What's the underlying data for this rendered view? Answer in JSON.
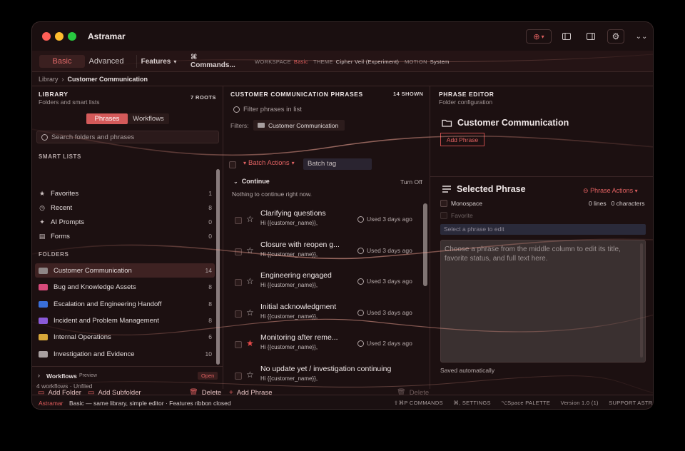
{
  "app": {
    "title": "Astramar"
  },
  "ribbon": {
    "mode_basic": "Basic",
    "mode_advanced": "Advanced",
    "features": "Features",
    "commands": "⌘ Commands...",
    "workspace_label": "WORKSPACE",
    "workspace_value": "Basic",
    "theme_label": "THEME",
    "theme_value": "Cipher Veil (Experiment)",
    "motion_label": "MOTION",
    "motion_value": "System"
  },
  "breadcrumb": {
    "root": "Library",
    "current": "Customer Communication"
  },
  "library": {
    "title": "LIBRARY",
    "subtitle": "Folders and smart lists",
    "roots": "7 ROOTS",
    "tab_phrases": "Phrases",
    "tab_workflows": "Workflows",
    "search_placeholder": "Search folders and phrases",
    "smart_lists_title": "SMART LISTS",
    "smart_lists": [
      {
        "label": "Favorites",
        "count": "1",
        "icon": "star-icon"
      },
      {
        "label": "Recent",
        "count": "8",
        "icon": "clock-icon"
      },
      {
        "label": "AI Prompts",
        "count": "0",
        "icon": "sparkle-icon"
      },
      {
        "label": "Forms",
        "count": "0",
        "icon": "form-icon"
      }
    ],
    "folders_title": "FOLDERS",
    "folders": [
      {
        "label": "Customer Communication",
        "count": "14",
        "color": "#8e8686"
      },
      {
        "label": "Bug and Knowledge Assets",
        "count": "8",
        "color": "#d64a7a"
      },
      {
        "label": "Escalation and Engineering Handoff",
        "count": "8",
        "color": "#3a6fd8"
      },
      {
        "label": "Incident and Problem Management",
        "count": "8",
        "color": "#8a5ad8"
      },
      {
        "label": "Internal Operations",
        "count": "6",
        "color": "#d8a83a"
      },
      {
        "label": "Investigation and Evidence",
        "count": "10",
        "color": "#a8a0a0"
      }
    ],
    "workflows_title": "Workflows",
    "workflows_preview": "Preview",
    "workflows_open": "Open",
    "workflows_sub": "4 workflows · Unfiled",
    "add_folder": "Add Folder",
    "add_subfolder": "Add Subfolder",
    "delete": "Delete"
  },
  "phrases": {
    "title": "CUSTOMER COMMUNICATION PHRASES",
    "shown": "14 SHOWN",
    "filter_placeholder": "Filter phrases in list",
    "filters_label": "Filters:",
    "filter_chip": "Customer Communication",
    "batch_actions": "Batch Actions",
    "batch_tag": "Batch tag",
    "continue_title": "Continue",
    "turn_off": "Turn Off",
    "continue_empty": "Nothing to continue right now.",
    "items": [
      {
        "title": "Clarifying questions",
        "snippet": "Hi {{customer_name}},",
        "used": "Used 3 days ago",
        "favorite": false
      },
      {
        "title": "Closure with reopen g...",
        "snippet": "Hi {{customer_name}},",
        "used": "Used 3 days ago",
        "favorite": false
      },
      {
        "title": "Engineering engaged",
        "snippet": "Hi {{customer_name}},",
        "used": "Used 3 days ago",
        "favorite": false
      },
      {
        "title": "Initial acknowledgment",
        "snippet": "Hi {{customer_name}},",
        "used": "Used 3 days ago",
        "favorite": false
      },
      {
        "title": "Monitoring after reme...",
        "snippet": "Hi {{customer_name}},",
        "used": "Used 2 days ago",
        "favorite": true
      },
      {
        "title": "No update yet / investigation continuing",
        "snippet": "Hi {{customer_name}},",
        "used": "",
        "favorite": false
      }
    ],
    "add_phrase": "Add Phrase",
    "delete": "Delete"
  },
  "editor": {
    "title": "PHRASE EDITOR",
    "subtitle": "Folder configuration",
    "folder_name": "Customer Communication",
    "add_phrase": "Add Phrase",
    "selected_title": "Selected Phrase",
    "phrase_actions": "Phrase Actions",
    "monospace": "Monospace",
    "favorite": "Favorite",
    "lines": "0 lines",
    "characters": "0 characters",
    "select_placeholder": "Select a phrase to edit",
    "body_placeholder": "Choose a phrase from the middle column to edit its title, favorite status, and full text here.",
    "saved": "Saved automatically"
  },
  "status": {
    "brand": "Astramar",
    "message": "Basic — same library, simple editor · Features ribbon closed",
    "commands": "⇧⌘P COMMANDS",
    "settings": "⌘, SETTINGS",
    "palette": "⌥Space PALETTE",
    "version": "Version 1.0 (1)",
    "support": "SUPPORT ASTRAMAR"
  },
  "colors": {
    "accent": "#e25c5c",
    "background": "#1c1011"
  }
}
